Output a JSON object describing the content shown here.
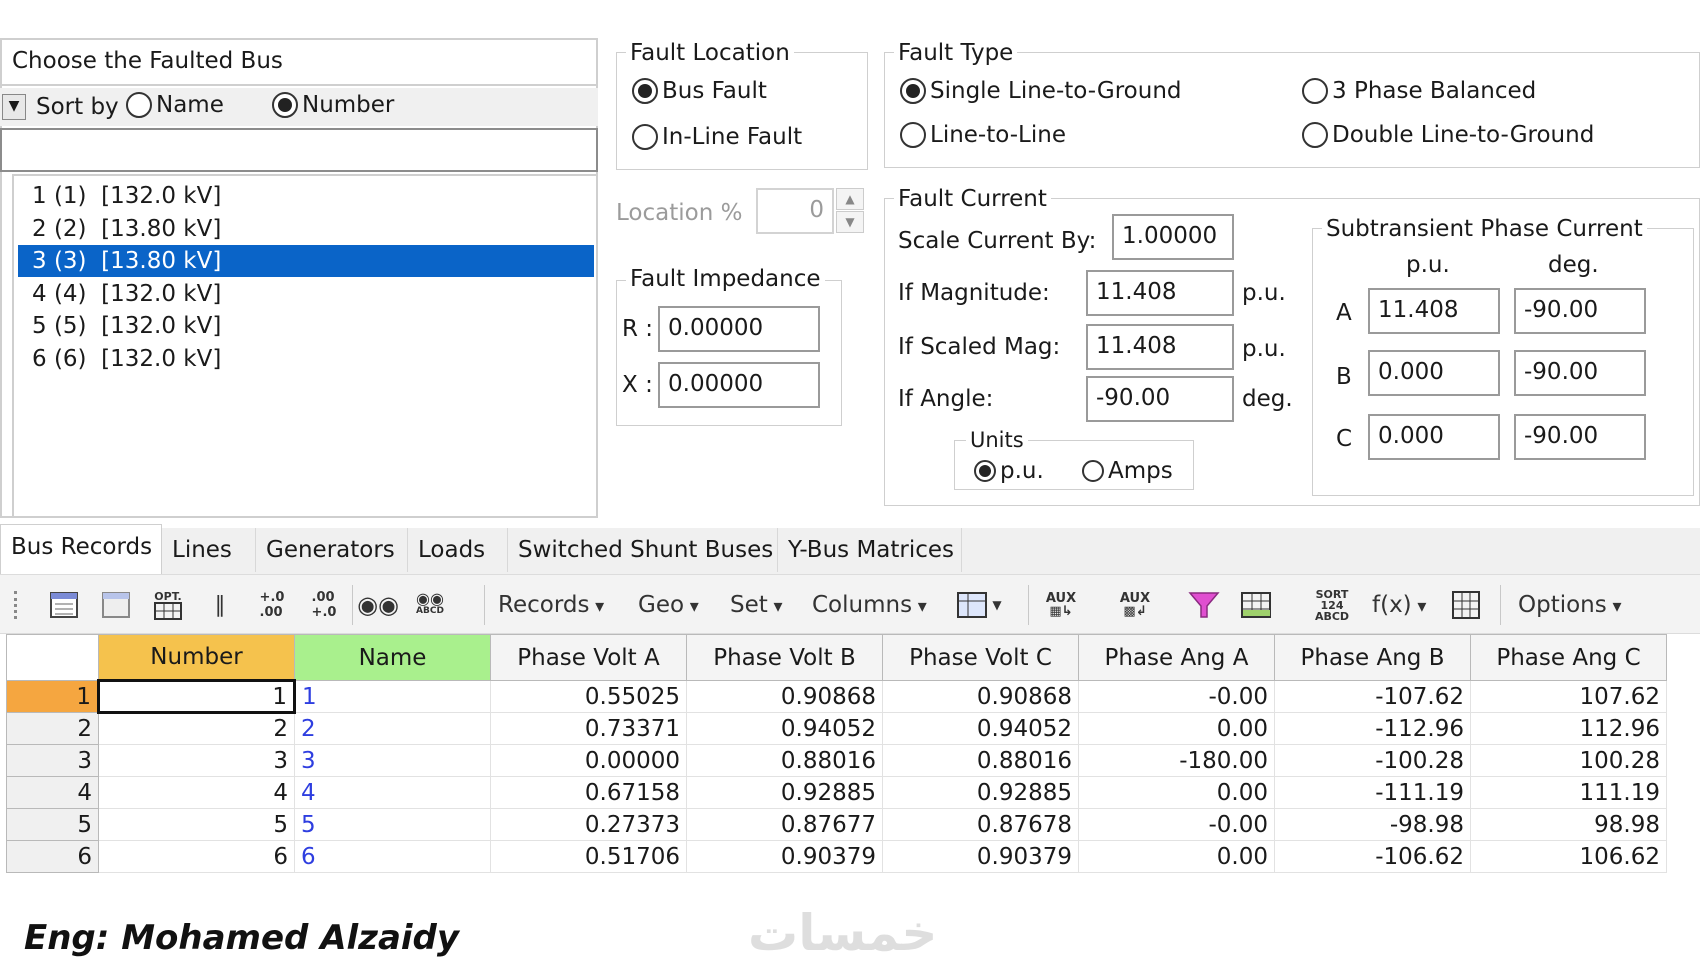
{
  "bus_chooser": {
    "title": "Choose the Faulted Bus",
    "sort_label": "Sort by",
    "sort_options": [
      {
        "label": "Name",
        "selected": false
      },
      {
        "label": "Number",
        "selected": true
      }
    ],
    "filter_value": "",
    "buses": [
      {
        "label": "1 (1)  [132.0 kV]",
        "selected": false
      },
      {
        "label": "2 (2)  [13.80 kV]",
        "selected": false
      },
      {
        "label": "3 (3)  [13.80 kV]",
        "selected": true
      },
      {
        "label": "4 (4)  [132.0 kV]",
        "selected": false
      },
      {
        "label": "5 (5)  [132.0 kV]",
        "selected": false
      },
      {
        "label": "6 (6)  [132.0 kV]",
        "selected": false
      }
    ]
  },
  "fault_location": {
    "title": "Fault Location",
    "options": [
      {
        "label": "Bus Fault",
        "selected": true
      },
      {
        "label": "In-Line Fault",
        "selected": false
      }
    ],
    "location_label": "Location %",
    "location_value": "0"
  },
  "fault_impedance": {
    "title": "Fault Impedance",
    "r_label": "R :",
    "r_value": "0.00000",
    "x_label": "X :",
    "x_value": "0.00000"
  },
  "fault_type": {
    "title": "Fault Type",
    "options": [
      {
        "label": "Single Line-to-Ground",
        "selected": true
      },
      {
        "label": "Line-to-Line",
        "selected": false
      },
      {
        "label": "3 Phase Balanced",
        "selected": false
      },
      {
        "label": "Double Line-to-Ground",
        "selected": false
      }
    ]
  },
  "fault_current": {
    "title": "Fault Current",
    "scale_label": "Scale Current By:",
    "scale_value": "1.00000",
    "magnitude_label": "If Magnitude:",
    "magnitude_value": "11.408",
    "magnitude_unit": "p.u.",
    "scaled_label": "If Scaled Mag:",
    "scaled_value": "11.408",
    "scaled_unit": "p.u.",
    "angle_label": "If Angle:",
    "angle_value": "-90.00",
    "angle_unit": "deg.",
    "units_title": "Units",
    "units_options": [
      {
        "label": "p.u.",
        "selected": true
      },
      {
        "label": "Amps",
        "selected": false
      }
    ]
  },
  "subtransient": {
    "title": "Subtransient Phase Current",
    "col_pu": "p.u.",
    "col_deg": "deg.",
    "rows": [
      {
        "phase": "A",
        "pu": "11.408",
        "deg": "-90.00"
      },
      {
        "phase": "B",
        "pu": "0.000",
        "deg": "-90.00"
      },
      {
        "phase": "C",
        "pu": "0.000",
        "deg": "-90.00"
      }
    ]
  },
  "tabs": [
    "Bus Records",
    "Lines",
    "Generators",
    "Loads",
    "Switched Shunt Buses",
    "Y-Bus Matrices"
  ],
  "active_tab": "Bus Records",
  "toolbar": {
    "records": "Records",
    "geo": "Geo",
    "set": "Set",
    "columns": "Columns",
    "fx": "f(x)",
    "options": "Options",
    "icon_texts": {
      "opt": "OPT.",
      "aux": "AUX",
      "sort": "SORT",
      "abcd": "ABCD"
    }
  },
  "table": {
    "headers": [
      "Number",
      "Name",
      "Phase Volt A",
      "Phase Volt B",
      "Phase Volt C",
      "Phase Ang A",
      "Phase Ang B",
      "Phase Ang C"
    ],
    "rows": [
      {
        "row": "1",
        "number": "1",
        "name": "1",
        "va": "0.55025",
        "vb": "0.90868",
        "vc": "0.90868",
        "aa": "-0.00",
        "ab": "-107.62",
        "ac": "107.62"
      },
      {
        "row": "2",
        "number": "2",
        "name": "2",
        "va": "0.73371",
        "vb": "0.94052",
        "vc": "0.94052",
        "aa": "0.00",
        "ab": "-112.96",
        "ac": "112.96"
      },
      {
        "row": "3",
        "number": "3",
        "name": "3",
        "va": "0.00000",
        "vb": "0.88016",
        "vc": "0.88016",
        "aa": "-180.00",
        "ab": "-100.28",
        "ac": "100.28"
      },
      {
        "row": "4",
        "number": "4",
        "name": "4",
        "va": "0.67158",
        "vb": "0.92885",
        "vc": "0.92885",
        "aa": "0.00",
        "ab": "-111.19",
        "ac": "111.19"
      },
      {
        "row": "5",
        "number": "5",
        "name": "5",
        "va": "0.27373",
        "vb": "0.87677",
        "vc": "0.87678",
        "aa": "-0.00",
        "ab": "-98.98",
        "ac": "98.98"
      },
      {
        "row": "6",
        "number": "6",
        "name": "6",
        "va": "0.51706",
        "vb": "0.90379",
        "vc": "0.90379",
        "aa": "0.00",
        "ab": "-106.62",
        "ac": "106.62"
      }
    ]
  },
  "footer": {
    "author": "Eng: Mohamed Alzaidy",
    "watermark": "خمسات"
  },
  "colors": {
    "selection": "#0a64c8",
    "number_header": "#f5c24d",
    "name_header": "#a9f08d",
    "name_link": "#2e3ee0",
    "current_row_marker": "#f5a640"
  }
}
